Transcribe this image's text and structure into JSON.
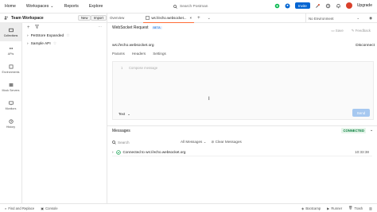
{
  "topbar": {
    "nav": [
      "Home",
      "Workspaces",
      "Reports",
      "Explore"
    ],
    "search_placeholder": "Search Postman",
    "invite_label": "Invite",
    "upgrade_label": "Upgrade"
  },
  "workspace": {
    "name": "Team Workspace",
    "new_label": "New",
    "import_label": "Import"
  },
  "tabs": [
    {
      "label": "Overview"
    },
    {
      "label": "ws://echo.websocket..."
    }
  ],
  "environment": {
    "selected": "No Environment"
  },
  "rail": [
    {
      "label": "Collections",
      "icon": "collections-icon"
    },
    {
      "label": "APIs",
      "icon": "apis-icon"
    },
    {
      "label": "Environments",
      "icon": "environments-icon"
    },
    {
      "label": "Mock Servers",
      "icon": "mock-servers-icon"
    },
    {
      "label": "Monitors",
      "icon": "monitors-icon"
    },
    {
      "label": "History",
      "icon": "history-icon"
    }
  ],
  "tree": [
    {
      "label": "PetStore Expanded"
    },
    {
      "label": "Sample API"
    }
  ],
  "request": {
    "title": "WebSocket Request",
    "badge": "BETA",
    "save_label": "Save",
    "feedback_label": "Feedback",
    "url": "ws://echo.websocket.org",
    "disconnect_label": "Disconnect",
    "subtabs": [
      "Params",
      "Headers",
      "Settings"
    ],
    "line_number": "1",
    "composer_placeholder": "Compose message",
    "format_label": "Text",
    "send_label": "Send"
  },
  "messages": {
    "title": "Messages",
    "status": "CONNECTED",
    "search_placeholder": "Search",
    "filter_label": "All Messages",
    "clear_label": "Clear Messages",
    "entries": [
      {
        "text": "Connected to ws://echo.websocket.org",
        "time": "10:33:38"
      }
    ]
  },
  "bottombar": {
    "left": [
      "Find and Replace",
      "Console"
    ],
    "right": [
      "Bootcamp",
      "Runner",
      "Trash"
    ]
  }
}
